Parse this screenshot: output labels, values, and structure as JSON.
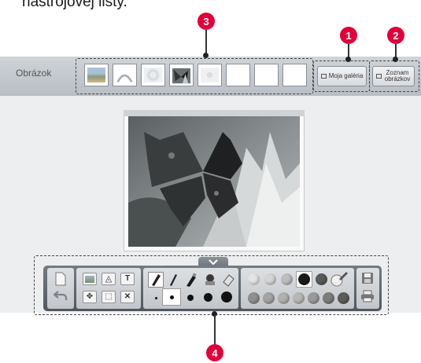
{
  "caption": "nástrojovej lišty.",
  "callouts": [
    "1",
    "2",
    "3",
    "4"
  ],
  "header": {
    "title": "Obrázok",
    "thumbnails": [
      "landscape-thumbnail",
      "arch-thumbnail",
      "sphere-thumbnail",
      "butterfly-thumbnail",
      "flower-thumbnail",
      "empty",
      "empty",
      "empty"
    ],
    "my_gallery_label": "Moja galéria",
    "image_list_label": "Zoznam obrázkov"
  },
  "canvas": {
    "image": "butterfly-on-flower"
  },
  "toolbar": {
    "file_tools": [
      "new-page-icon",
      "undo-icon"
    ],
    "image_tools": [
      "image-icon",
      "shape-icon",
      "text-icon",
      "move-icon",
      "zoom-icon",
      "delete-icon"
    ],
    "pen_tools": [
      "brush-icon",
      "pen-icon",
      "marker-icon",
      "stamp-icon",
      "eraser-icon"
    ],
    "brush_sizes": [
      "size-1",
      "size-2",
      "size-3",
      "size-4",
      "size-5"
    ],
    "palette_top": [
      "#c9c9c9",
      "#bcbcbc",
      "#9a9a9a",
      "#1a1a1a",
      "#5a5a5a"
    ],
    "palette_bottom": [
      "#8f8f8f",
      "#a3a3a3",
      "#b0b0b0",
      "#b7b7b7",
      "#9a9a9a",
      "#7c7c7c",
      "#5c5c5c"
    ],
    "right_tools": [
      "save-icon",
      "print-icon"
    ]
  }
}
